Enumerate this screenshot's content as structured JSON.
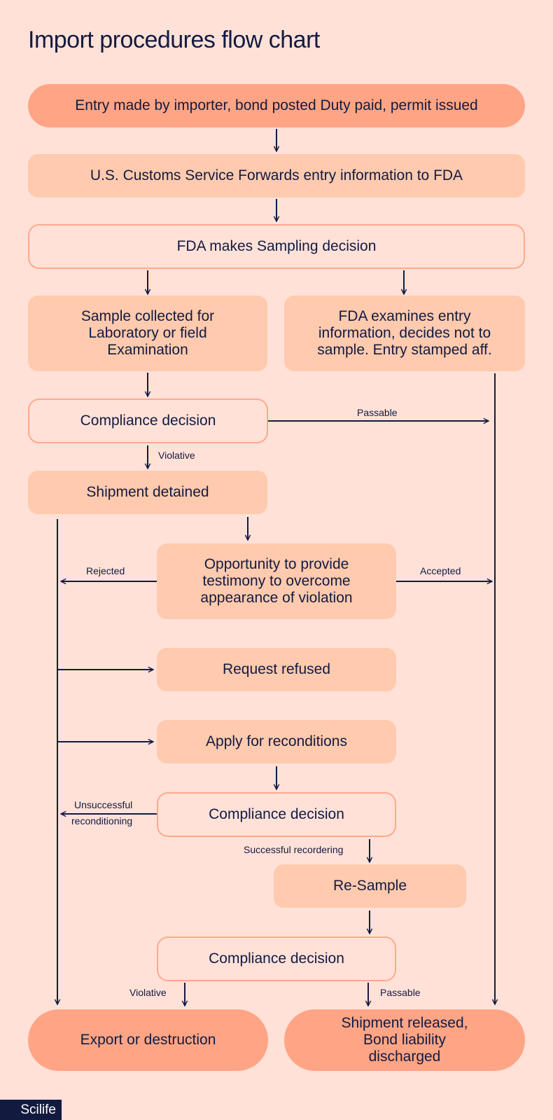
{
  "title": "Import procedures flow chart",
  "nodes": {
    "entry": "Entry made by importer, bond posted Duty paid, permit issued",
    "customs": "U.S. Customs Service Forwards entry information to FDA",
    "sampling_decision": "FDA makes Sampling decision",
    "sample_collected": "Sample collected for Laboratory or field Examination",
    "no_sample": "FDA examines entry information, decides not to sample. Entry stamped aff.",
    "compliance_1": "Compliance decision",
    "detained": "Shipment detained",
    "opportunity": "Opportunity to provide testimony to overcome appearance of violation",
    "request_refused": "Request refused",
    "apply_recondition": "Apply for reconditions",
    "compliance_2": "Compliance decision",
    "resample": "Re-Sample",
    "compliance_3": "Compliance decision",
    "export": "Export or destruction",
    "released": "Shipment released, Bond liability discharged"
  },
  "edge_labels": {
    "passable_1": "Passable",
    "violative_1": "Violative",
    "rejected": "Rejected",
    "accepted": "Accepted",
    "unsuccessful_1": "Unsuccessful",
    "unsuccessful_2": "reconditioning",
    "successful": "Successful recordering",
    "violative_2": "Violative",
    "passable_2": "Passable"
  },
  "brand": "Scilife",
  "colors": {
    "background": "#ffe1d8",
    "terminal": "#ffa585",
    "process": "#ffcaae",
    "decision_border": "#ffaa8c",
    "ink": "#131a40"
  }
}
